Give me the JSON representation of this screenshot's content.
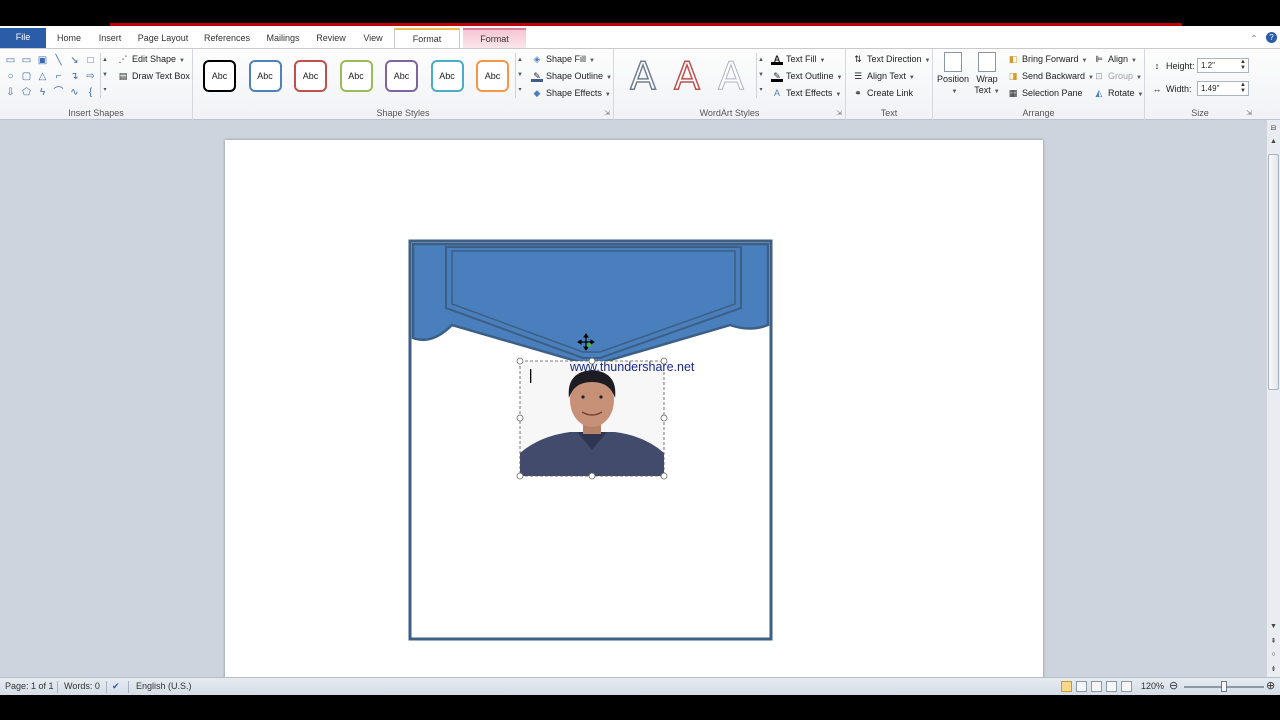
{
  "tabs": [
    {
      "label": "File",
      "kind": "file"
    },
    {
      "label": "Home"
    },
    {
      "label": "Insert"
    },
    {
      "label": "Page Layout"
    },
    {
      "label": "References"
    },
    {
      "label": "Mailings"
    },
    {
      "label": "Review"
    },
    {
      "label": "View"
    },
    {
      "label": "Format",
      "kind": "active"
    },
    {
      "label": "Format",
      "kind": "contextual"
    }
  ],
  "ribbon": {
    "insert_shapes": {
      "label": "Insert Shapes",
      "edit_shape": "Edit Shape",
      "draw_text_box": "Draw Text Box"
    },
    "shape_styles": {
      "label": "Shape Styles",
      "preset_text": "Abc",
      "preset_colors": [
        "#000000",
        "#4f81bd",
        "#c0504d",
        "#9bbb59",
        "#8064a2",
        "#4bacc6",
        "#f79646"
      ],
      "shape_fill": "Shape Fill",
      "shape_outline": "Shape Outline",
      "shape_effects": "Shape Effects"
    },
    "wordart_styles": {
      "label": "WordArt Styles",
      "letter": "A",
      "text_fill": "Text Fill",
      "text_outline": "Text Outline",
      "text_effects": "Text Effects"
    },
    "text": {
      "label": "Text",
      "text_direction": "Text Direction",
      "align_text": "Align Text",
      "create_link": "Create Link"
    },
    "arrange": {
      "label": "Arrange",
      "position": "Position",
      "wrap_text_line1": "Wrap",
      "wrap_text_line2": "Text",
      "bring_forward": "Bring Forward",
      "send_backward": "Send Backward",
      "selection_pane": "Selection Pane",
      "align": "Align",
      "group": "Group",
      "rotate": "Rotate"
    },
    "size": {
      "label": "Size",
      "height_label": "Height:",
      "height_value": "1.2\"",
      "width_label": "Width:",
      "width_value": "1.49\""
    }
  },
  "document": {
    "card_outline_color": "#3d5f85",
    "header_fill_color": "#4a7fbe",
    "textbox_text": "www.thundershare.net"
  },
  "status_bar": {
    "page": "Page: 1 of 1",
    "words": "Words: 0",
    "language": "English (U.S.)",
    "zoom": "120%"
  }
}
